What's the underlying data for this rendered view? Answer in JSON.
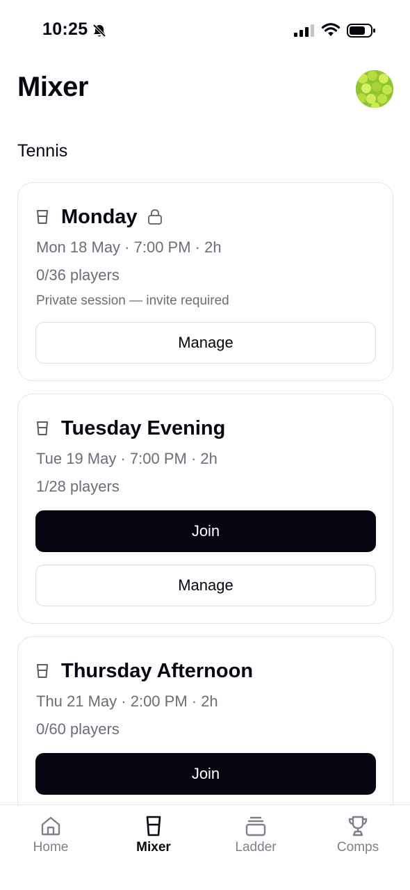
{
  "status_bar": {
    "time": "10:25"
  },
  "header": {
    "title": "Mixer"
  },
  "section": {
    "title": "Tennis"
  },
  "sessions": [
    {
      "title": "Monday",
      "locked": true,
      "when": "Mon 18 May · 7:00 PM · 2h",
      "players": "0/36 players",
      "note": "Private session — invite required",
      "manage_label": "Manage"
    },
    {
      "title": "Tuesday Evening",
      "locked": false,
      "when": "Tue 19 May · 7:00 PM · 2h",
      "players": "1/28 players",
      "join_label": "Join",
      "manage_label": "Manage"
    },
    {
      "title": "Thursday Afternoon",
      "locked": false,
      "when": "Thu 21 May · 2:00 PM · 2h",
      "players": "0/60 players",
      "join_label": "Join"
    }
  ],
  "tabs": [
    {
      "label": "Home",
      "icon": "home-icon",
      "active": false
    },
    {
      "label": "Mixer",
      "icon": "glass-icon",
      "active": true
    },
    {
      "label": "Ladder",
      "icon": "ladder-icon",
      "active": false
    },
    {
      "label": "Comps",
      "icon": "trophy-icon",
      "active": false
    }
  ],
  "colors": {
    "primary": "#05060f",
    "muted_text": "#6b6e78",
    "border": "#e3e4e8",
    "avatar": "#8fc532"
  }
}
